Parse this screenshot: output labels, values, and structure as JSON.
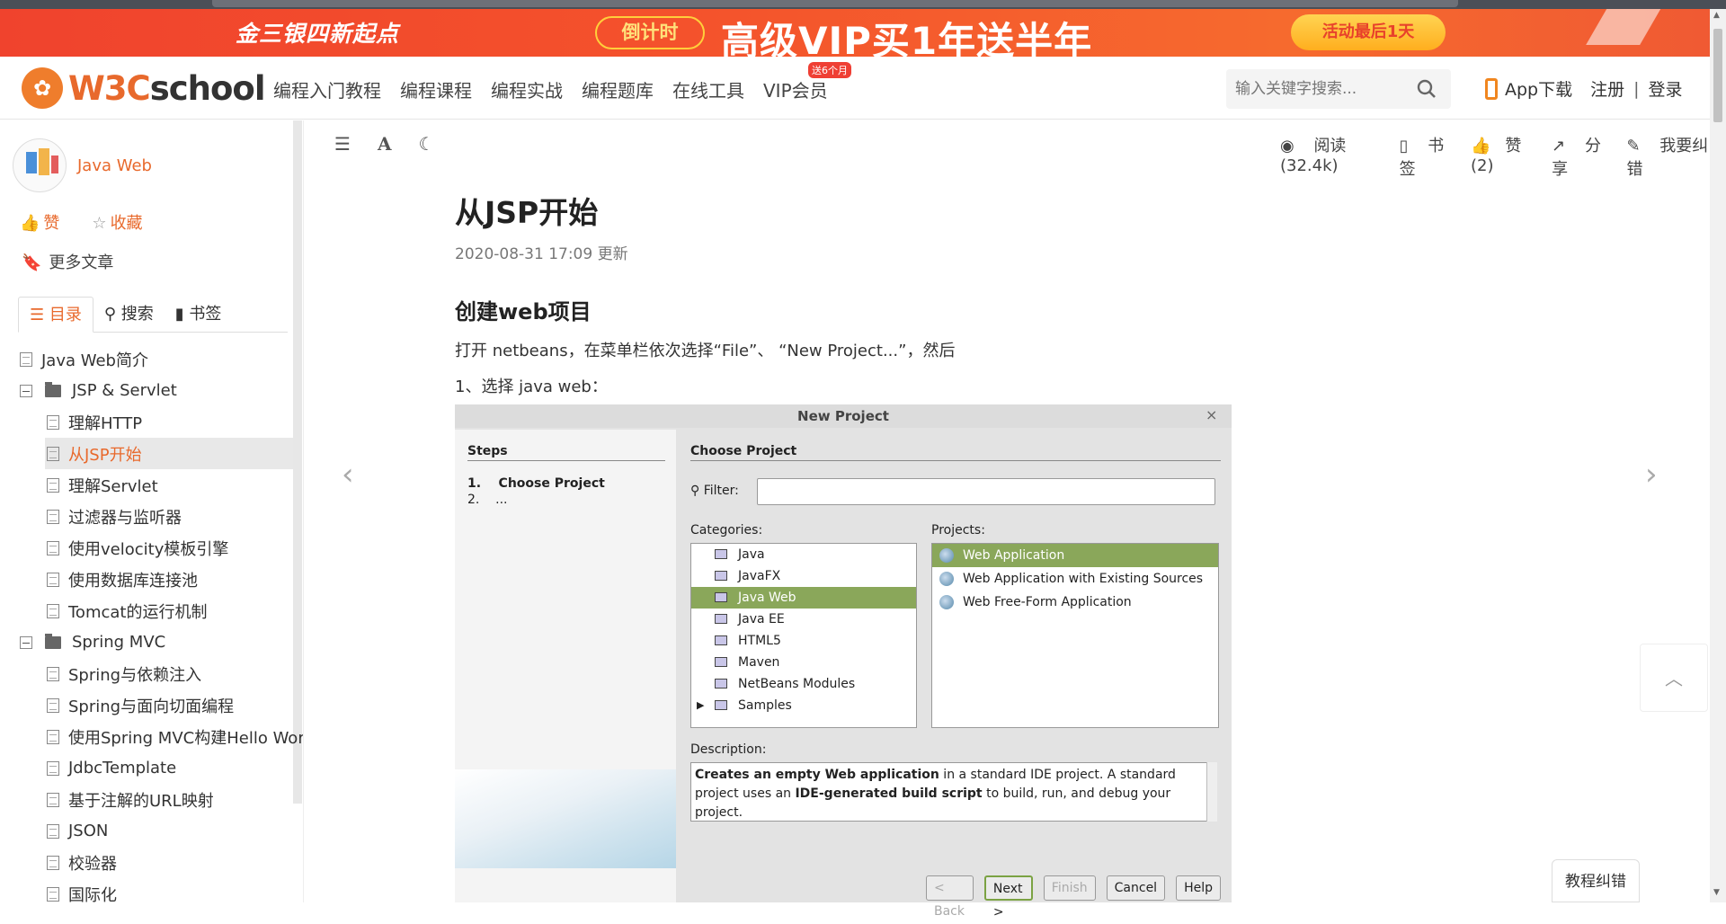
{
  "banner": {
    "left_text": "金三银四新起点",
    "countdown": "倒计时",
    "promo": "高级VIP买1年送半年",
    "activity": "活动最后1天"
  },
  "header": {
    "logo_text_w": "W3C",
    "logo_text_rest": "school",
    "nav": [
      {
        "label": "编程入门教程"
      },
      {
        "label": "编程课程"
      },
      {
        "label": "编程实战"
      },
      {
        "label": "编程题库"
      },
      {
        "label": "在线工具"
      },
      {
        "label": "VIP会员",
        "badge": "送6个月"
      }
    ],
    "search_placeholder": "输入关键字搜索...",
    "app_download": "App下载",
    "register": "注册",
    "separator": "|",
    "login": "登录"
  },
  "sidebar": {
    "course_title": "Java Web",
    "like": "赞",
    "collect": "收藏",
    "more_articles": "更多文章",
    "tabs": [
      "目录",
      "搜索",
      "书签"
    ],
    "toc": [
      {
        "label": "Java Web简介",
        "type": "doc",
        "level": 0
      },
      {
        "label": "JSP & Servlet",
        "type": "folder",
        "level": 0
      },
      {
        "label": "理解HTTP",
        "type": "doc",
        "level": 1
      },
      {
        "label": "从JSP开始",
        "type": "doc",
        "level": 1,
        "active": true
      },
      {
        "label": "理解Servlet",
        "type": "doc",
        "level": 1
      },
      {
        "label": "过滤器与监听器",
        "type": "doc",
        "level": 1
      },
      {
        "label": "使用velocity模板引擎",
        "type": "doc",
        "level": 1
      },
      {
        "label": "使用数据库连接池",
        "type": "doc",
        "level": 1
      },
      {
        "label": "Tomcat的运行机制",
        "type": "doc",
        "level": 1
      },
      {
        "label": "Spring MVC",
        "type": "folder",
        "level": 0
      },
      {
        "label": "Spring与依赖注入",
        "type": "doc",
        "level": 1
      },
      {
        "label": "Spring与面向切面编程",
        "type": "doc",
        "level": 1
      },
      {
        "label": "使用Spring MVC构建Hello Worl",
        "type": "doc",
        "level": 1
      },
      {
        "label": "JdbcTemplate",
        "type": "doc",
        "level": 1
      },
      {
        "label": "基于注解的URL映射",
        "type": "doc",
        "level": 1
      },
      {
        "label": "JSON",
        "type": "doc",
        "level": 1
      },
      {
        "label": "校验器",
        "type": "doc",
        "level": 1
      },
      {
        "label": "国际化",
        "type": "doc",
        "level": 1
      }
    ]
  },
  "toolbar": {
    "font_icon": "A",
    "reads": "阅读(32.4k)",
    "bookmark": "书签",
    "likes": "赞(2)",
    "share": "分享",
    "report": "我要纠错"
  },
  "article": {
    "title": "从JSP开始",
    "date": "2020-08-31 17:09 更新",
    "h2": "创建web项目",
    "p1": "打开 netbeans，在菜单栏依次选择“File”、 “New Project...”，然后",
    "p2": "1、选择 java web："
  },
  "dialog": {
    "title": "New Project",
    "close": "×",
    "steps_header": "Steps",
    "step1": "1.    Choose Project",
    "step2": "2.    ...",
    "choose_header": "Choose Project",
    "filter_label": "Filter:",
    "categories_label": "Categories:",
    "projects_label": "Projects:",
    "categories": [
      "Java",
      "JavaFX",
      "Java Web",
      "Java EE",
      "HTML5",
      "Maven",
      "NetBeans Modules",
      "Samples"
    ],
    "selected_category": "Java Web",
    "projects": [
      "Web Application",
      "Web Application with Existing Sources",
      "Web Free-Form Application"
    ],
    "selected_project": "Web Application",
    "description_label": "Description:",
    "description_bold1": "Creates an empty Web application",
    "description_text1": " in a standard IDE project. A standard project uses an ",
    "description_bold2": "IDE-generated build script",
    "description_text2": " to build, run, and debug your project.",
    "buttons": [
      "< Back",
      "Next >",
      "Finish",
      "Cancel",
      "Help"
    ]
  },
  "floating": {
    "feedback": "教程纠错"
  },
  "colors": {
    "brand": "#e8692c",
    "banner": "#f0432d",
    "selection_green": "#8aa75a"
  }
}
